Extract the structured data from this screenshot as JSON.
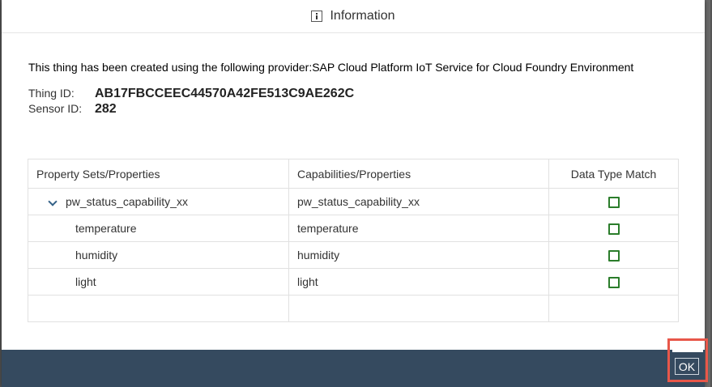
{
  "dialog": {
    "title": "Information",
    "title_icon": "info-icon",
    "provider_text": "This thing has been created using the following provider:SAP Cloud Platform IoT Service for Cloud Foundry Environment",
    "thing_id_label": "Thing ID:",
    "thing_id_value": "AB17FBCCEEC44570A42FE513C9AE262C",
    "sensor_id_label": "Sensor ID:",
    "sensor_id_value": "282"
  },
  "table": {
    "headers": [
      "Property Sets/Properties",
      "Capabilities/Properties",
      "Data Type Match"
    ],
    "rows": [
      {
        "property": "pw_status_capability_xx",
        "capability": "pw_status_capability_xx",
        "match": true,
        "expandable": true
      },
      {
        "property": "temperature",
        "capability": "temperature",
        "match": true
      },
      {
        "property": "humidity",
        "capability": "humidity",
        "match": true
      },
      {
        "property": "light",
        "capability": "light",
        "match": true
      }
    ]
  },
  "footer": {
    "ok_label": "OK"
  },
  "colors": {
    "footer_bg": "#354a5f",
    "check_green": "#2b7d2b",
    "highlight": "#e8574a",
    "chevron": "#346187"
  }
}
